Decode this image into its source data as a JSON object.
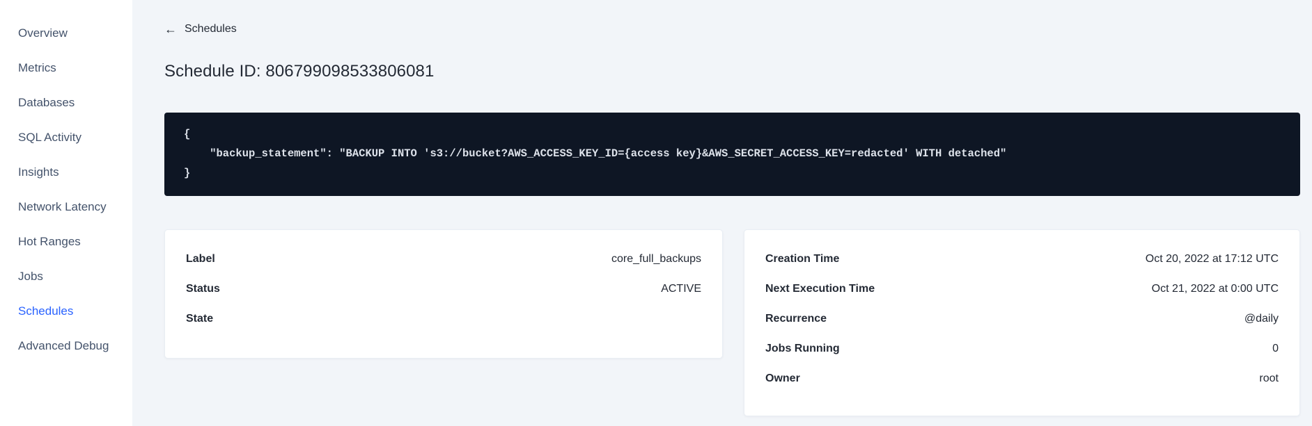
{
  "sidebar": {
    "items": [
      {
        "label": "Overview"
      },
      {
        "label": "Metrics"
      },
      {
        "label": "Databases"
      },
      {
        "label": "SQL Activity"
      },
      {
        "label": "Insights"
      },
      {
        "label": "Network Latency"
      },
      {
        "label": "Hot Ranges"
      },
      {
        "label": "Jobs"
      },
      {
        "label": "Schedules"
      },
      {
        "label": "Advanced Debug"
      }
    ],
    "active_item": "Schedules"
  },
  "header": {
    "back_icon": "←",
    "back_label": "Schedules",
    "title": "Schedule ID: 806799098533806081"
  },
  "code_block": {
    "lines": [
      "{",
      "    \"backup_statement\": \"BACKUP INTO 's3://bucket?AWS_ACCESS_KEY_ID={access key}&AWS_SECRET_ACCESS_KEY=redacted' WITH detached\"",
      "}"
    ]
  },
  "cards": {
    "left": {
      "rows": [
        {
          "label": "Label",
          "value": "core_full_backups"
        },
        {
          "label": "Status",
          "value": "ACTIVE"
        },
        {
          "label": "State",
          "value": ""
        }
      ]
    },
    "right": {
      "rows": [
        {
          "label": "Creation Time",
          "value": "Oct 20, 2022 at 17:12 UTC"
        },
        {
          "label": "Next Execution Time",
          "value": "Oct 21, 2022 at 0:00 UTC"
        },
        {
          "label": "Recurrence",
          "value": "@daily"
        },
        {
          "label": "Jobs Running",
          "value": "0"
        },
        {
          "label": "Owner",
          "value": "root"
        }
      ]
    }
  },
  "colors": {
    "accent": "#2962ff",
    "code_background": "#0e1624",
    "main_background": "#f2f5f9",
    "text": "#242a35"
  }
}
